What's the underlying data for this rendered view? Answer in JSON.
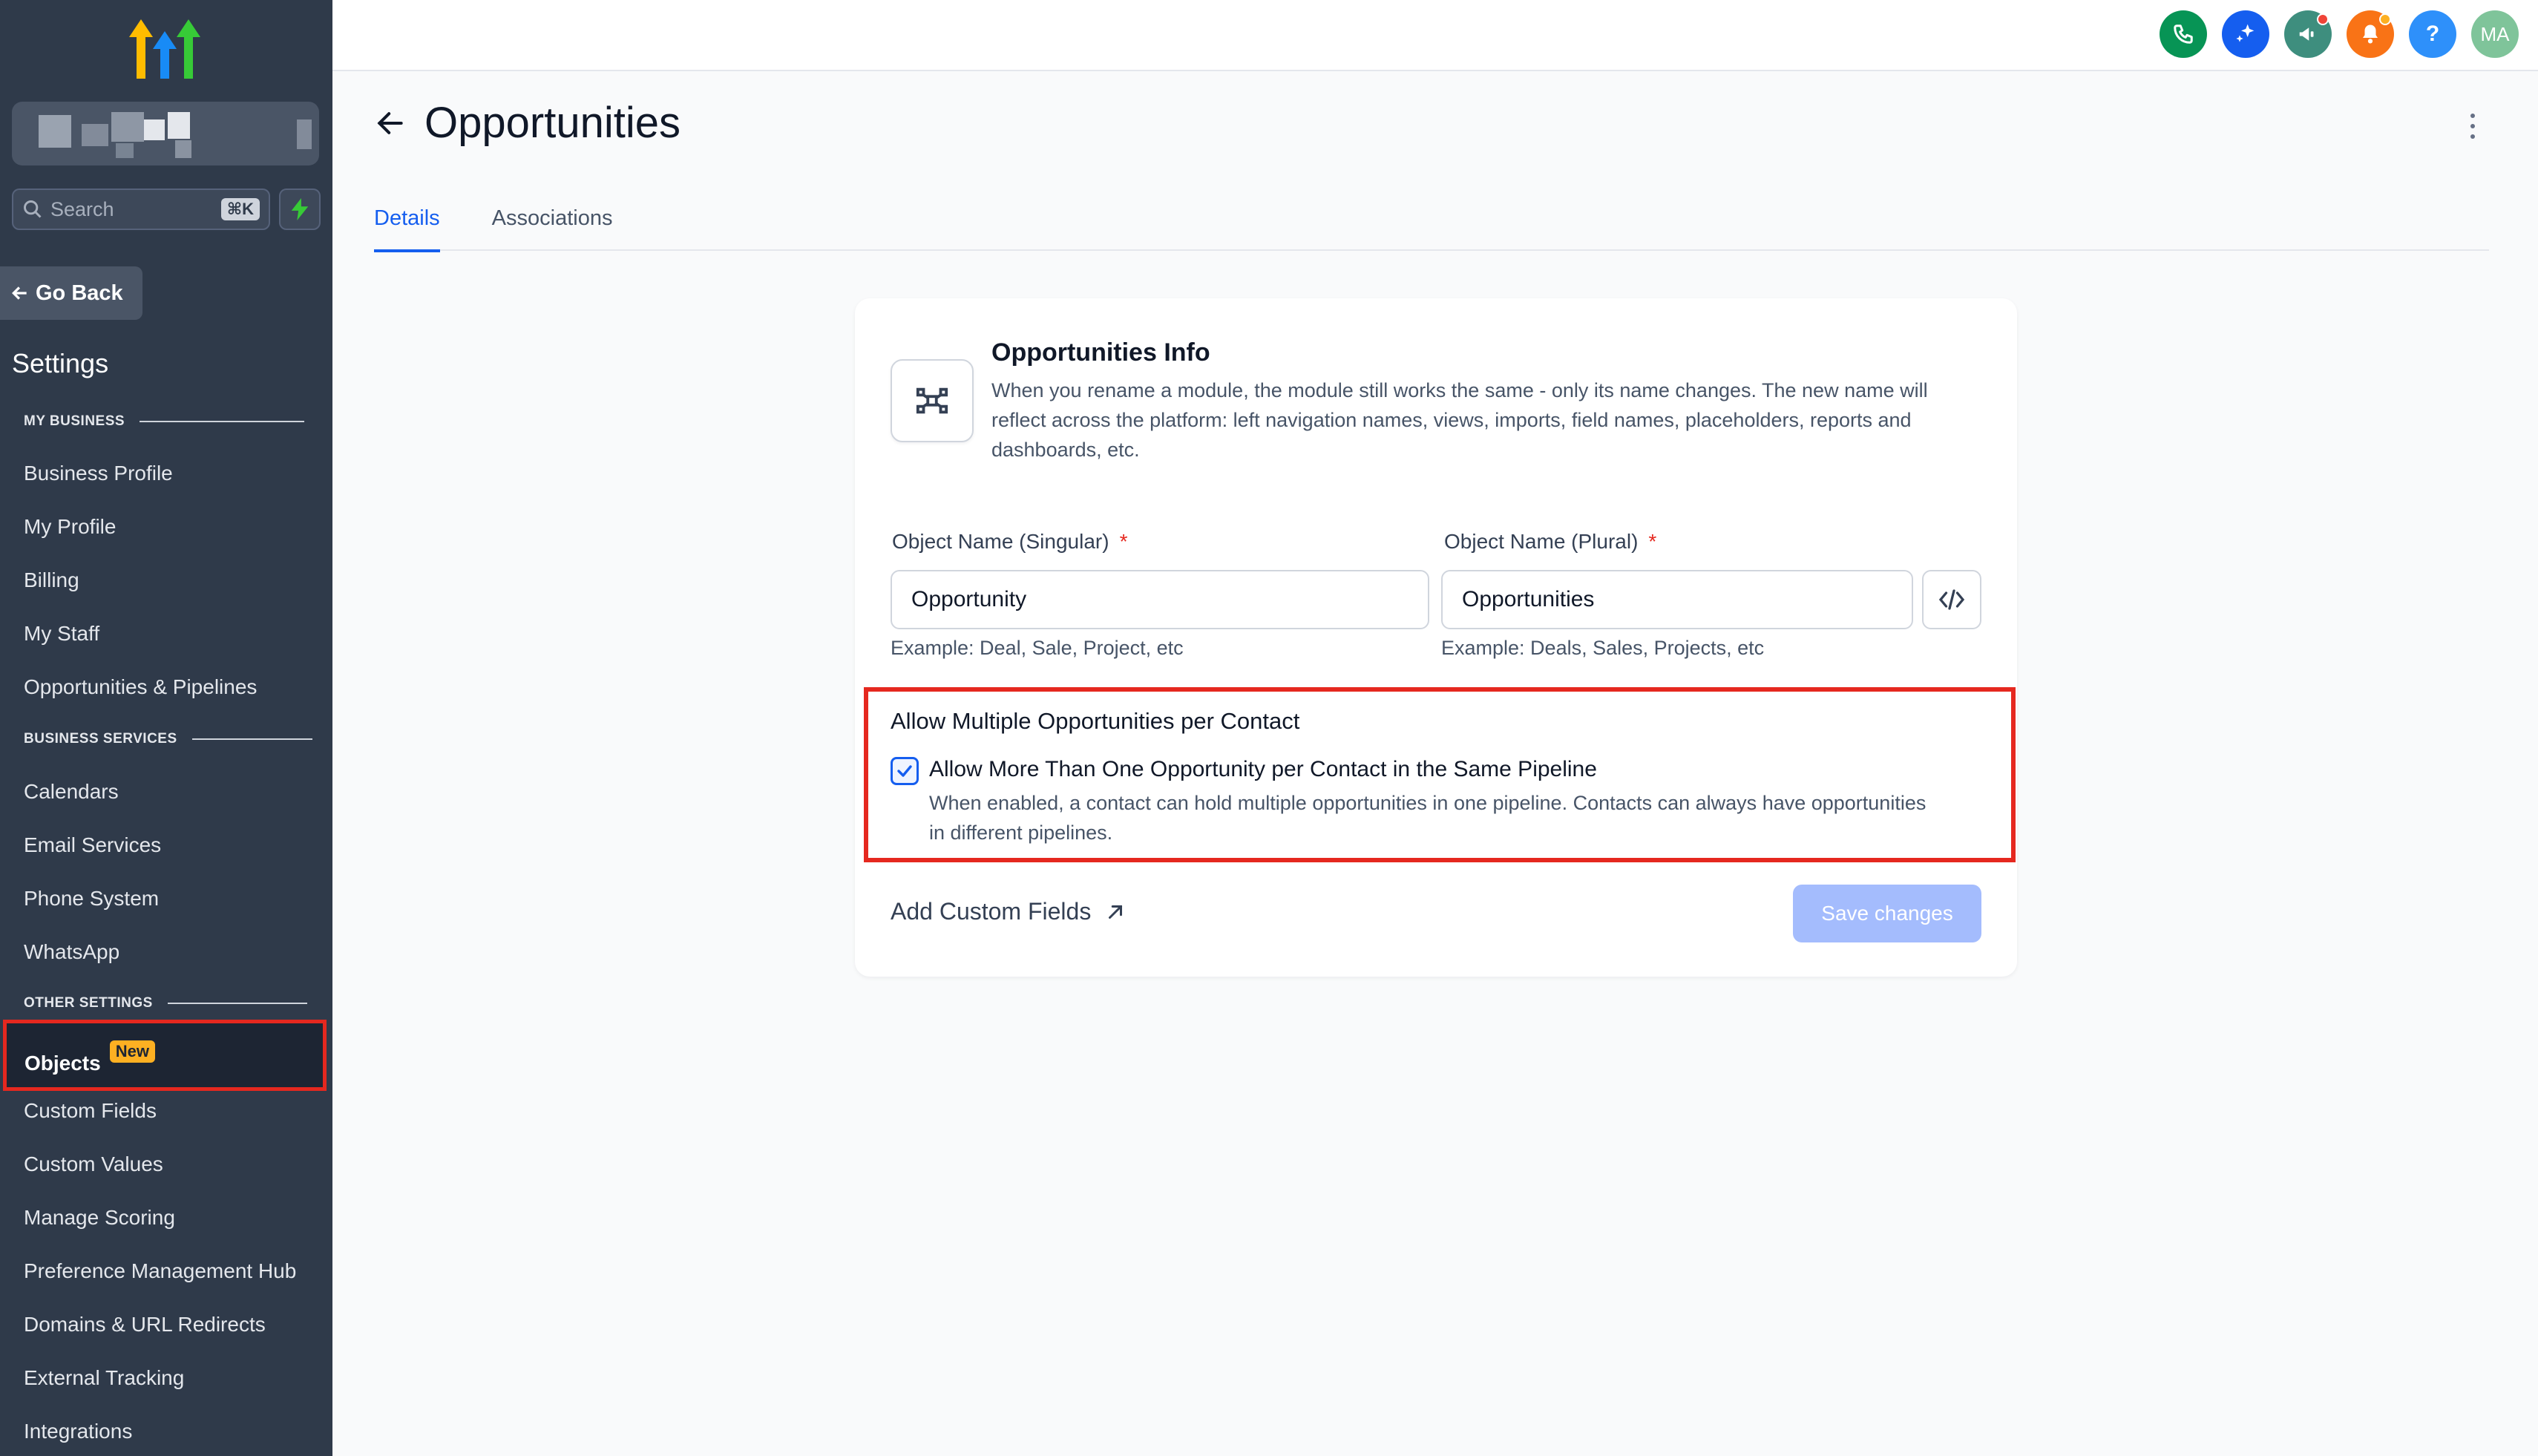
{
  "sidebar": {
    "search_placeholder": "Search",
    "search_shortcut": "⌘K",
    "go_back": "Go Back",
    "settings_title": "Settings",
    "sections": {
      "my_business": "MY BUSINESS",
      "business_services": "BUSINESS SERVICES",
      "other_settings": "OTHER SETTINGS"
    },
    "my_business_items": [
      "Business Profile",
      "My Profile",
      "Billing",
      "My Staff",
      "Opportunities & Pipelines"
    ],
    "business_services_items": [
      "Calendars",
      "Email Services",
      "Phone System",
      "WhatsApp"
    ],
    "active_item": "Objects",
    "active_badge": "New",
    "other_settings_items": [
      "Custom Fields",
      "Custom Values",
      "Manage Scoring",
      "Preference Management Hub",
      "Domains & URL Redirects",
      "External Tracking",
      "Integrations"
    ]
  },
  "topbar": {
    "help_label": "?",
    "avatar_initials": "MA",
    "colors": {
      "phone": "#079455",
      "ai": "#155eef",
      "announce": "#3e8e7e",
      "notify": "#f04438",
      "help": "#2e90fa",
      "avatar": "#7fc49a"
    }
  },
  "page": {
    "title": "Opportunities",
    "tabs": [
      {
        "label": "Details",
        "active": true
      },
      {
        "label": "Associations",
        "active": false
      }
    ]
  },
  "card": {
    "info_title": "Opportunities Info",
    "info_desc": "When you rename a module, the module still works the same - only its name changes. The new name will reflect across the platform: left navigation names, views, imports, field names, placeholders, reports and dashboards, etc.",
    "singular": {
      "label": "Object Name (Singular)",
      "required": "*",
      "value": "Opportunity",
      "hint": "Example: Deal, Sale, Project, etc"
    },
    "plural": {
      "label": "Object Name (Plural)",
      "required": "*",
      "value": "Opportunities",
      "hint": "Example: Deals, Sales, Projects, etc"
    },
    "multi_section_title": "Allow Multiple Opportunities per Contact",
    "multi_checkbox_label": "Allow More Than One Opportunity per Contact in the Same Pipeline",
    "multi_checkbox_checked": true,
    "multi_checkbox_desc": "When enabled, a contact can hold multiple opportunities in one pipeline. Contacts can always have opportunities in different pipelines.",
    "add_custom_fields": "Add Custom Fields",
    "save_button": "Save changes"
  }
}
